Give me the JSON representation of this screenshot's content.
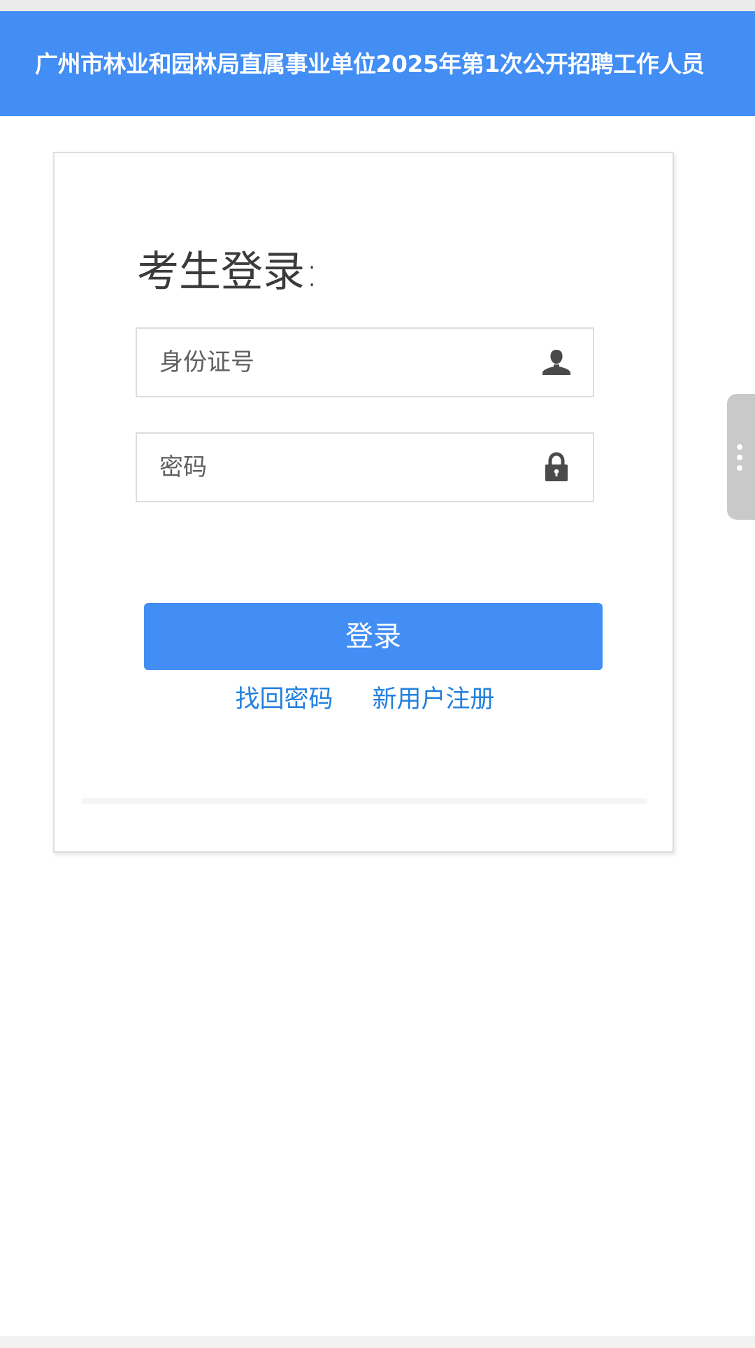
{
  "header": {
    "title": "广州市林业和园林局直属事业单位2025年第1次公开招聘工作人员"
  },
  "login": {
    "heading": "考生登录:",
    "id_field": {
      "placeholder": "身份证号",
      "value": "",
      "icon": "user-icon"
    },
    "password_field": {
      "placeholder": "密码",
      "value": "",
      "icon": "lock-icon"
    },
    "submit_label": "登录",
    "links": {
      "recover_password": "找回密码",
      "register": "新用户注册"
    }
  },
  "side_tab": {
    "icon": "more-vertical-icon"
  },
  "colors": {
    "primary": "#428ef4",
    "link": "#2380dd",
    "icon": "#4a4a4a",
    "side_tab": "#c9c9c9"
  }
}
